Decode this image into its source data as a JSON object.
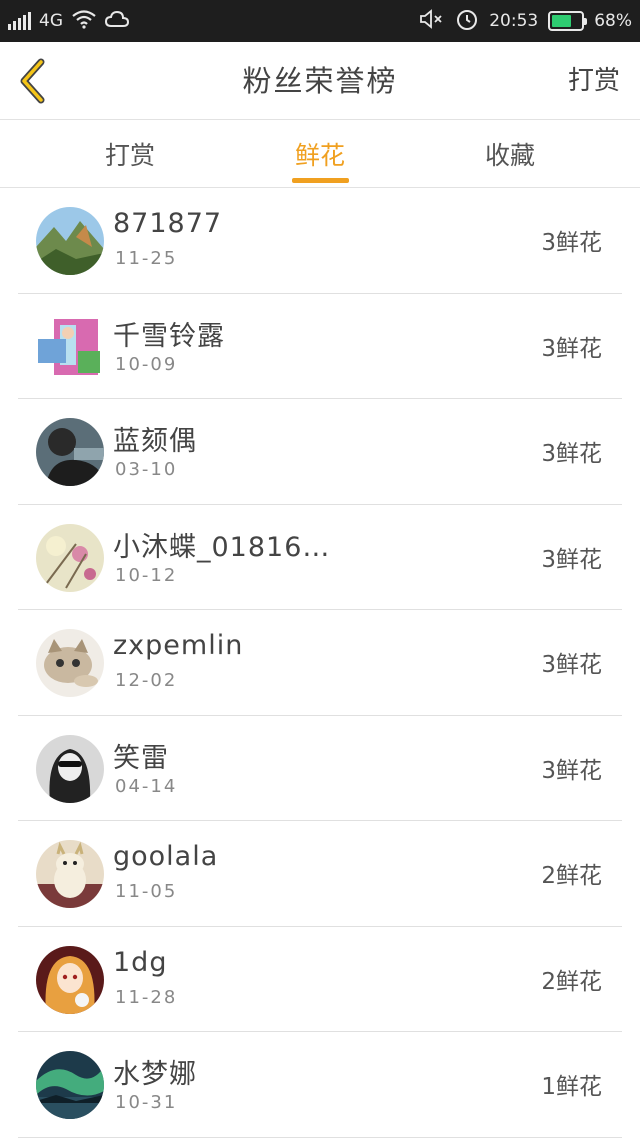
{
  "statusbar": {
    "network": "4G",
    "time": "20:53",
    "battery": "68%",
    "battery_level": 0.68,
    "battery_color": "#2ecc71",
    "icons": [
      "signal-icon",
      "wifi-icon",
      "cloud-icon",
      "mute-icon",
      "alarm-icon",
      "battery-icon"
    ]
  },
  "header": {
    "back_icon": "chevron-left-icon",
    "title": "粉丝荣誉榜",
    "action_label": "打赏"
  },
  "tabs": [
    {
      "label": "打赏",
      "active": false
    },
    {
      "label": "鲜花",
      "active": true
    },
    {
      "label": "收藏",
      "active": false
    }
  ],
  "accent_color": "#f0a020",
  "fans": [
    {
      "name": "871877",
      "date": "11-25",
      "count": "3鲜花",
      "avatar": "mountain-avatar"
    },
    {
      "name": "千雪铃露",
      "date": "10-09",
      "count": "3鲜花",
      "avatar": "collage-avatar"
    },
    {
      "name": "蓝颏偶",
      "date": "03-10",
      "count": "3鲜花",
      "avatar": "person-dark-avatar"
    },
    {
      "name": "小沐蝶_01816…",
      "date": "10-12",
      "count": "3鲜花",
      "avatar": "flower-avatar"
    },
    {
      "name": "zxpemlin",
      "date": "12-02",
      "count": "3鲜花",
      "avatar": "kitten-avatar"
    },
    {
      "name": "笑雷",
      "date": "04-14",
      "count": "3鲜花",
      "avatar": "girl-bw-avatar"
    },
    {
      "name": "goolala",
      "date": "11-05",
      "count": "2鲜花",
      "avatar": "toy-avatar"
    },
    {
      "name": "1dg",
      "date": "11-28",
      "count": "2鲜花",
      "avatar": "anime-avatar"
    },
    {
      "name": "水梦娜",
      "date": "10-31",
      "count": "1鲜花",
      "avatar": "aurora-avatar"
    }
  ]
}
